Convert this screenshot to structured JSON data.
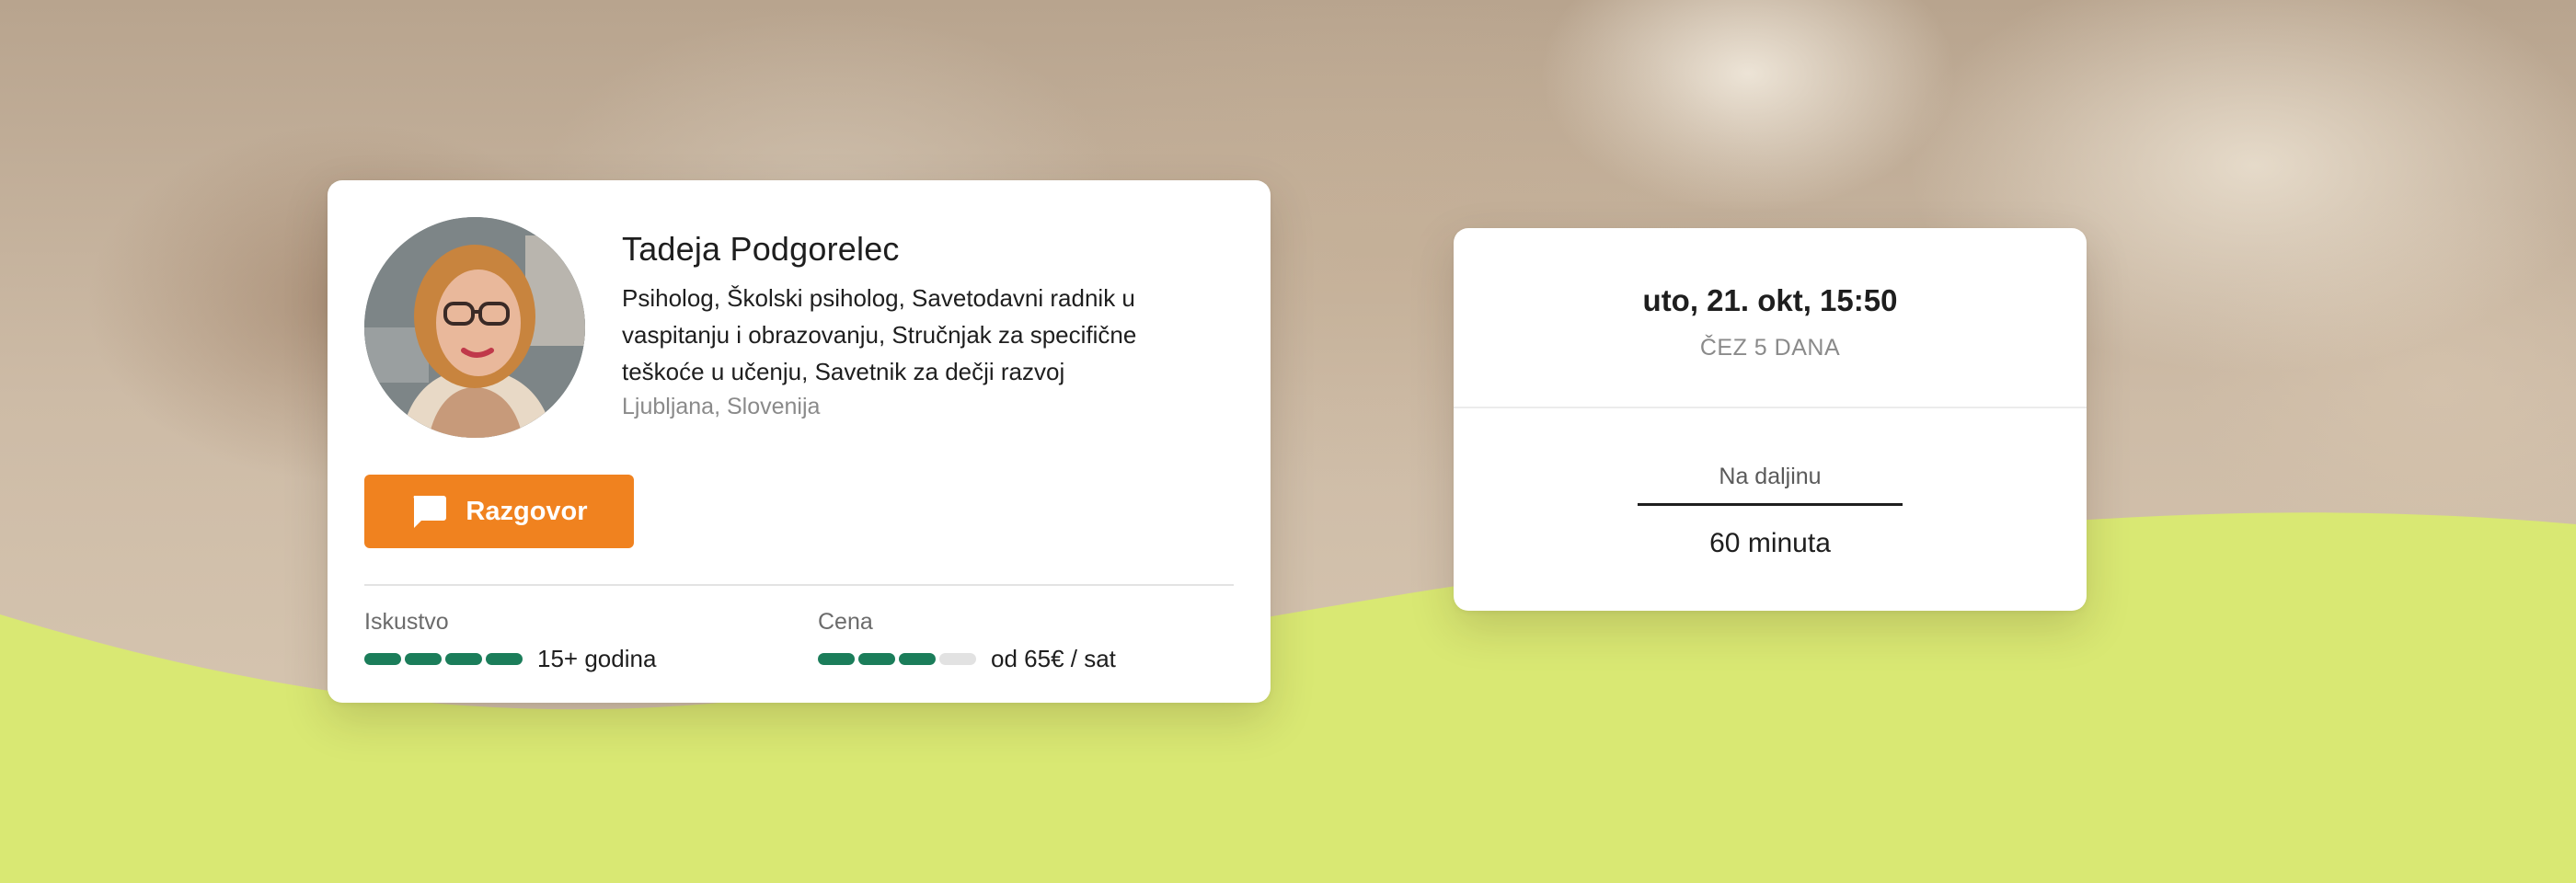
{
  "profile": {
    "name": "Tadeja Podgorelec",
    "titles": "Psiholog, Školski psiholog, Savetodavni radnik u vaspitanju i obrazovanju, Stručnjak za specifične teškoće u učenju, Savetnik za dečji razvoj",
    "location": "Ljubljana, Slovenija",
    "chat_button_label": "Razgovor",
    "chat_icon": "chat-bubble-icon",
    "experience": {
      "label": "Iskustvo",
      "value": "15+ godina",
      "level": 4,
      "max": 4
    },
    "price": {
      "label": "Cena",
      "value": "od 65€ / sat",
      "level": 3,
      "max": 4
    }
  },
  "session": {
    "date": "uto, 21. okt, 15:50",
    "relative": "ČEZ 5 DANA",
    "mode": "Na daljinu",
    "duration": "60 minuta"
  },
  "colors": {
    "accent_orange": "#f0821f",
    "rating_green": "#1b7d5a",
    "wave_lime": "#d9e873"
  }
}
